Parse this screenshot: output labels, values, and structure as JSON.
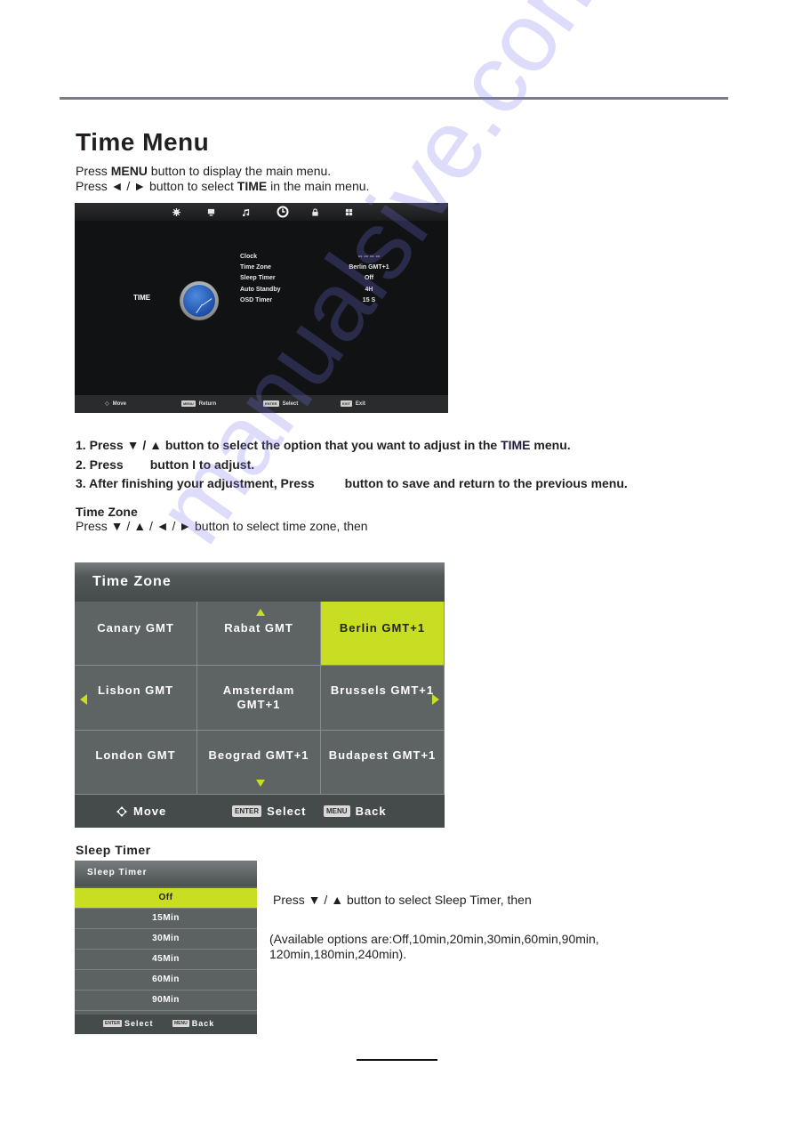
{
  "page": {
    "title": "Time Menu",
    "intro": [
      {
        "pre": "Press ",
        "bold": "MENU",
        "post": " button to display the main menu."
      },
      {
        "pre": "Press ◄ / ► button to select ",
        "bold": "TIME",
        "post": " in the main menu."
      }
    ]
  },
  "tv_menu": {
    "top_icons": [
      "picture-icon",
      "screen-icon",
      "sound-icon",
      "time-icon",
      "lock-icon",
      "setup-icon"
    ],
    "active_icon": "time-icon",
    "section_label": "TIME",
    "rows": [
      {
        "label": "Clock",
        "value": "-- --    -- --"
      },
      {
        "label": "Time Zone",
        "value": "Berlin GMT+1"
      },
      {
        "label": "Sleep Timer",
        "value": "Off"
      },
      {
        "label": "Auto Standby",
        "value": "4H"
      },
      {
        "label": "OSD Timer",
        "value": "15 S"
      }
    ],
    "footer": [
      {
        "key": "",
        "label": "Move"
      },
      {
        "key": "MENU",
        "label": "Return"
      },
      {
        "key": "ENTER",
        "label": "Select"
      },
      {
        "key": "EXIT",
        "label": "Exit"
      }
    ]
  },
  "steps": {
    "s1_pre": "1. Press ▼ / ▲ button  to select the option that you want to adjust in the ",
    "s1_bold": "TIME",
    "s1_post": " menu.",
    "s2_pre": "2. Press",
    "s2_post": "button I to adjust.",
    "s3_pre": "3. After finishing your adjustment, Press",
    "s3_post": "button to save and return to the previous menu."
  },
  "time_zone": {
    "heading": "Time Zone",
    "description": "Press ▼ / ▲ / ◄ / ► button to select time zone,  then",
    "panel_title": "Time Zone",
    "cells": [
      "Canary GMT",
      "Rabat GMT",
      "Berlin GMT+1",
      "Lisbon GMT",
      "Amsterdam GMT+1",
      "Brussels GMT+1",
      "London GMT",
      "Beograd GMT+1",
      "Budapest GMT+1"
    ],
    "selected": "Berlin GMT+1",
    "footer": {
      "move": "Move",
      "enter_key": "ENTER",
      "select": "Select",
      "menu_key": "MENU",
      "back": "Back"
    }
  },
  "sleep_timer": {
    "heading": "Sleep Timer",
    "panel_title": "Sleep Timer",
    "options": [
      "Off",
      "15Min",
      "30Min",
      "45Min",
      "60Min",
      "90Min"
    ],
    "selected": "Off",
    "footer": {
      "enter_key": "ENTER",
      "select": "Select",
      "menu_key": "MENU",
      "back": "Back"
    },
    "description": "Press ▼ / ▲ button to select Sleep Timer,  then",
    "available": "(Available options are:Off,10min,20min,30min,60min,90min, 120min,180min,240min)."
  },
  "colors": {
    "accent": "#c8de23",
    "panel": "#5e6364",
    "tv_bg": "#111213"
  },
  "watermark": "manualsive.com"
}
